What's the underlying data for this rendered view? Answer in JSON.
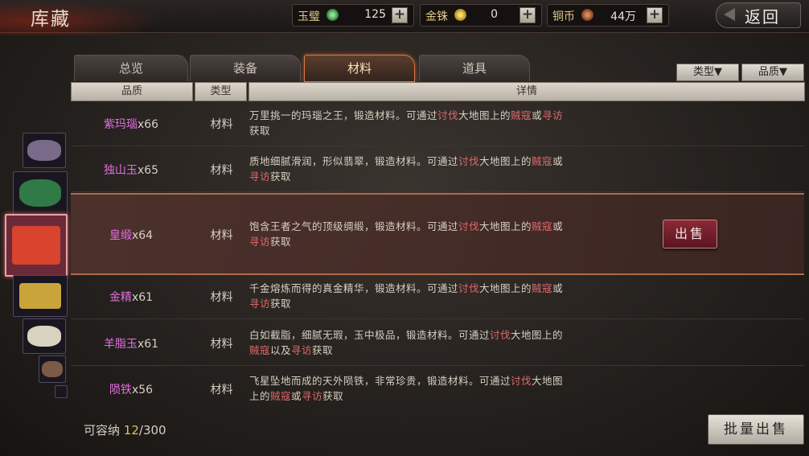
{
  "header": {
    "title": "库藏",
    "back_label": "返回",
    "resources": [
      {
        "label": "玉璧",
        "value": "125",
        "color": "#3e9a4a",
        "icon": "jade-coin-icon"
      },
      {
        "label": "金铢",
        "value": "0",
        "color": "#c9a227",
        "icon": "gold-coin-icon"
      },
      {
        "label": "铜币",
        "value": "44万",
        "color": "#a8603a",
        "icon": "copper-coin-icon"
      }
    ]
  },
  "tabs": [
    {
      "label": "总览"
    },
    {
      "label": "装备"
    },
    {
      "label": "材料"
    },
    {
      "label": "道具"
    }
  ],
  "filters": {
    "type_label": "类型▼",
    "quality_label": "品质▼"
  },
  "columns": {
    "quality": "品质",
    "type": "类型",
    "detail": "详情"
  },
  "items": [
    {
      "name": "紫玛瑙",
      "count": "x66",
      "type": "材料",
      "desc": [
        [
          "万里挑一的玛瑙之王，锻造材料。可通过",
          ""
        ],
        [
          "讨伐",
          "hl"
        ],
        [
          "大地图上的",
          ""
        ],
        [
          "贼寇",
          "hl"
        ],
        [
          "或",
          ""
        ],
        [
          "寻访",
          "hl"
        ],
        [
          "获取",
          ""
        ]
      ],
      "thumb_color": "#7a6a8a"
    },
    {
      "name": "独山玉",
      "count": "x65",
      "type": "材料",
      "desc": [
        [
          "质地细腻滑润，形似翡翠，锻造材料。可通过",
          ""
        ],
        [
          "讨伐",
          "hl"
        ],
        [
          "大地图上的",
          ""
        ],
        [
          "贼寇",
          "hl"
        ],
        [
          "或",
          ""
        ],
        [
          "寻访",
          "hl"
        ],
        [
          "获取",
          ""
        ]
      ],
      "thumb_color": "#2f7a46"
    },
    {
      "name": "皇缎",
      "count": "x64",
      "type": "材料",
      "desc": [
        [
          "饱含王者之气的顶级绸缎，锻造材料。可通过",
          ""
        ],
        [
          "讨伐",
          "hl"
        ],
        [
          "大地图上的",
          ""
        ],
        [
          "贼寇",
          "hl"
        ],
        [
          "或",
          ""
        ],
        [
          "寻访",
          "hl"
        ],
        [
          "获取",
          ""
        ]
      ],
      "thumb_color": "#d8442e",
      "selected": true,
      "sell_label": "出售"
    },
    {
      "name": "金精",
      "count": "x61",
      "type": "材料",
      "desc": [
        [
          "千金熔炼而得的真金精华，锻造材料。可通过",
          ""
        ],
        [
          "讨伐",
          "hl"
        ],
        [
          "大地图上的",
          ""
        ],
        [
          "贼寇",
          "hl"
        ],
        [
          "或",
          ""
        ],
        [
          "寻访",
          "hl"
        ],
        [
          "获取",
          ""
        ]
      ],
      "thumb_color": "#c9a43a"
    },
    {
      "name": "羊脂玉",
      "count": "x61",
      "type": "材料",
      "desc": [
        [
          "白如截脂，细腻无瑕，玉中极品，锻造材料。可通过",
          ""
        ],
        [
          "讨伐",
          "hl"
        ],
        [
          "大地图上的",
          ""
        ],
        [
          "贼寇",
          "hl"
        ],
        [
          "以及",
          ""
        ],
        [
          "寻访",
          "hl"
        ],
        [
          "获取",
          ""
        ]
      ],
      "thumb_color": "#d9d2c0"
    },
    {
      "name": "陨铁",
      "count": "x56",
      "type": "材料",
      "desc": [
        [
          "飞星坠地而成的天外陨铁，非常珍贵，锻造材料。可通过",
          ""
        ],
        [
          "讨伐",
          "hl"
        ],
        [
          "大地图上的",
          ""
        ],
        [
          "贼寇",
          "hl"
        ],
        [
          "或",
          ""
        ],
        [
          "寻访",
          "hl"
        ],
        [
          "获取",
          ""
        ]
      ],
      "thumb_color": "#7a5a48"
    }
  ],
  "capacity": {
    "label": "可容纳",
    "used": "12",
    "total": "/300"
  },
  "bulk_sell_label": "批量出售"
}
